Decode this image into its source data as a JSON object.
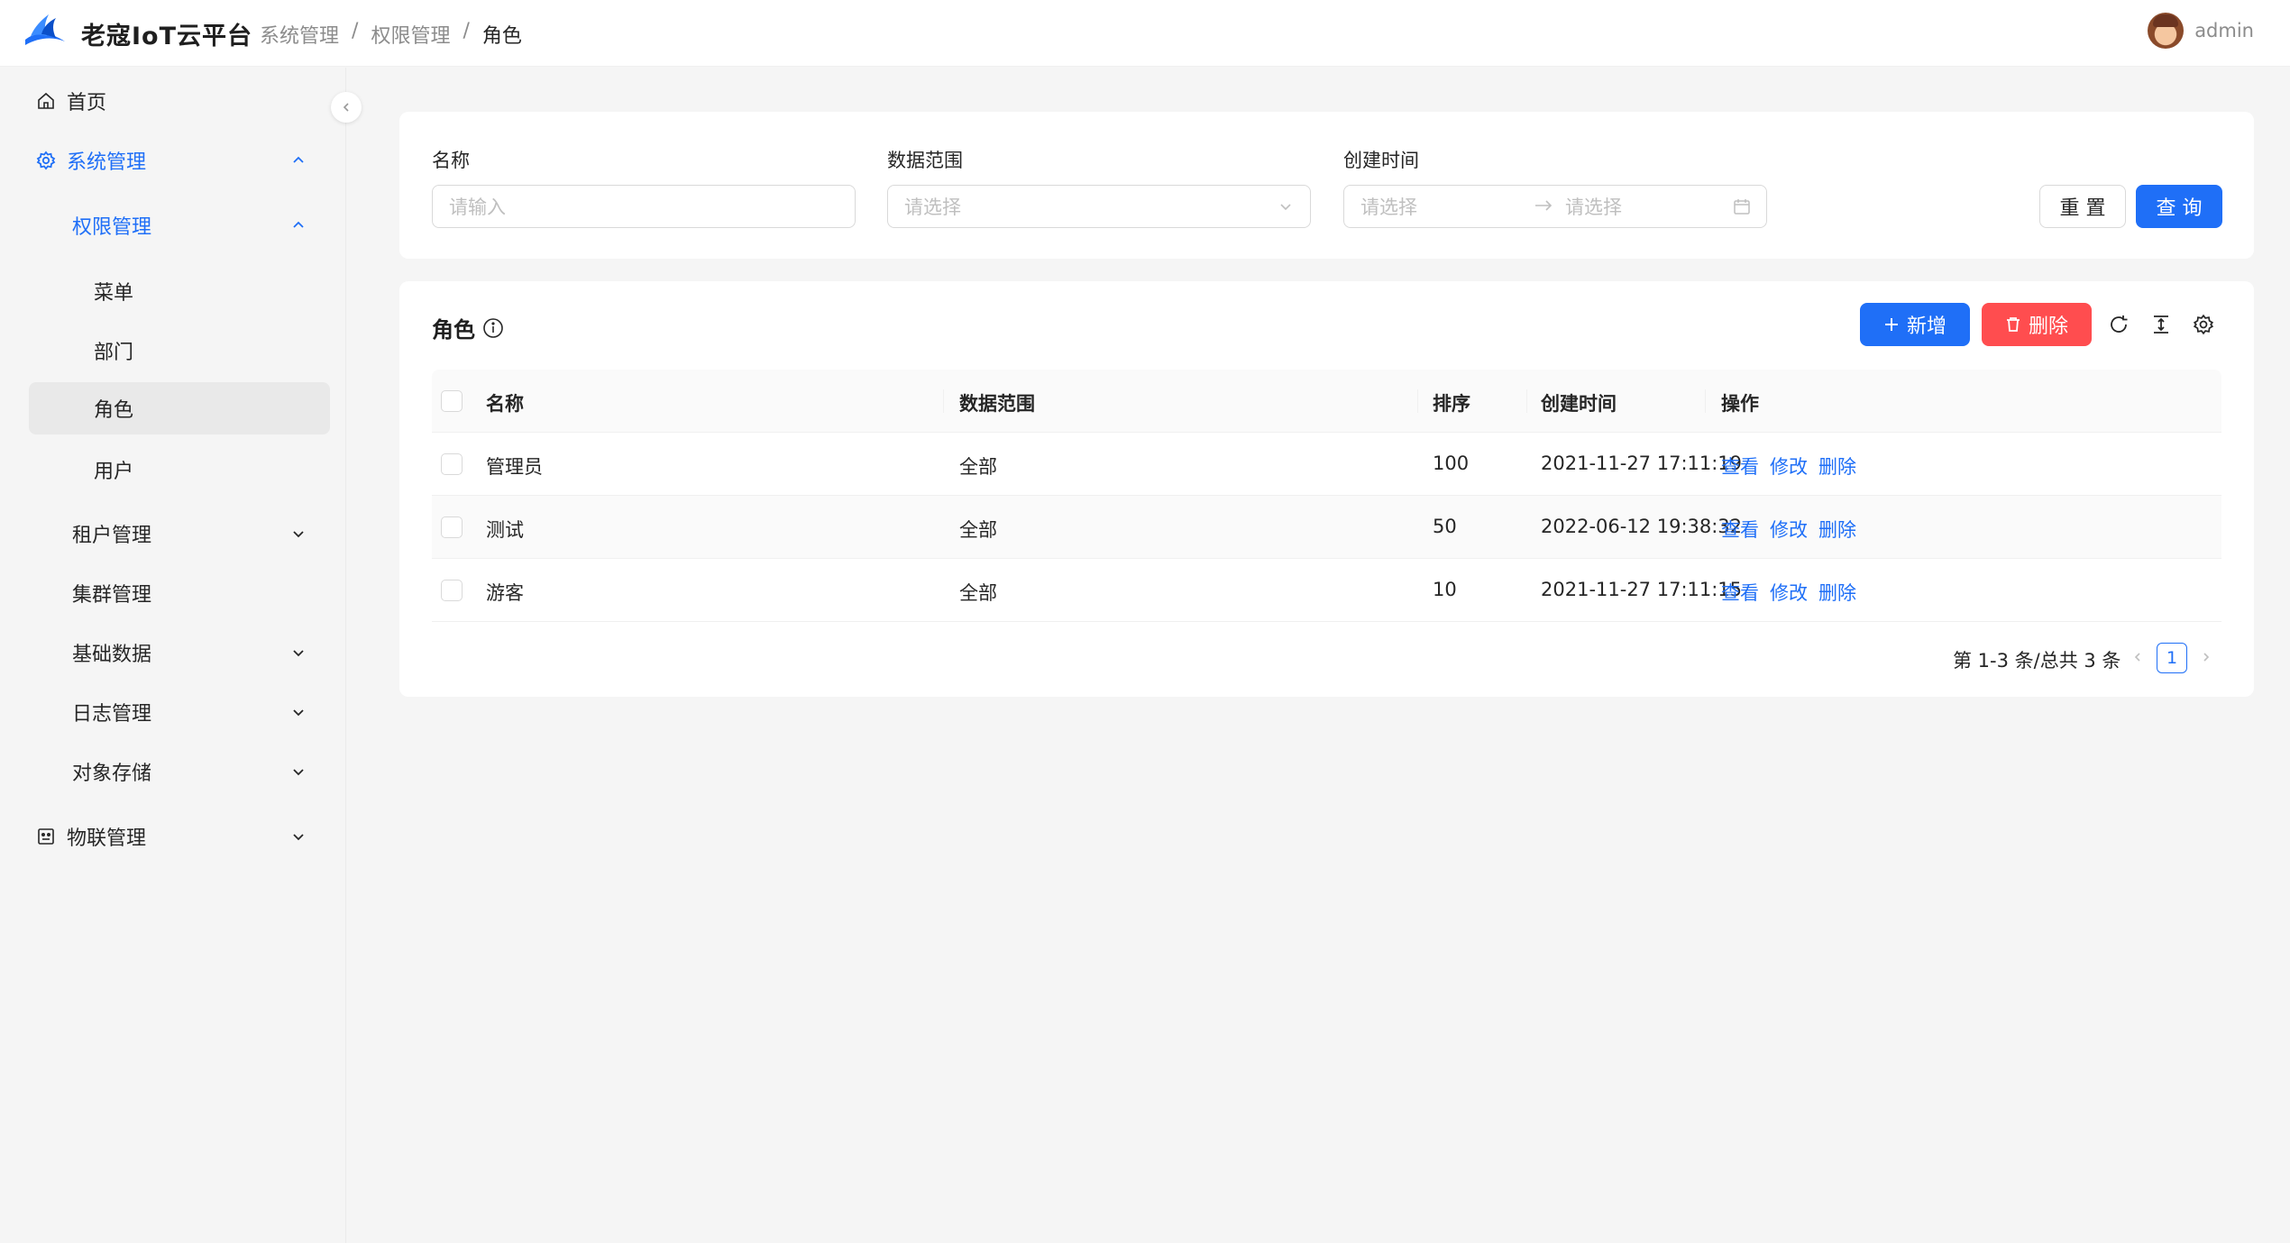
{
  "header": {
    "app_title": "老寇IoT云平台",
    "breadcrumb": [
      "系统管理",
      "权限管理",
      "角色"
    ],
    "breadcrumb_sep": "/",
    "username": "admin"
  },
  "sidebar": {
    "collapse_icon": "chevron-left-icon",
    "items": [
      {
        "label": "首页",
        "icon": "home-icon"
      },
      {
        "label": "系统管理",
        "icon": "gear-icon",
        "expanded": true
      },
      {
        "label": "权限管理",
        "expanded": true
      },
      {
        "label": "菜单"
      },
      {
        "label": "部门"
      },
      {
        "label": "角色",
        "selected": true
      },
      {
        "label": "用户"
      },
      {
        "label": "租户管理"
      },
      {
        "label": "集群管理"
      },
      {
        "label": "基础数据"
      },
      {
        "label": "日志管理"
      },
      {
        "label": "对象存储"
      },
      {
        "label": "物联管理",
        "icon": "robot-icon"
      }
    ]
  },
  "search": {
    "name_label": "名称",
    "name_placeholder": "请输入",
    "scope_label": "数据范围",
    "scope_placeholder": "请选择",
    "time_label": "创建时间",
    "time_start_placeholder": "请选择",
    "time_end_placeholder": "请选择",
    "reset_label": "重 置",
    "query_label": "查 询"
  },
  "table": {
    "title": "角色",
    "add_label": "新增",
    "delete_label": "删除",
    "columns": [
      "名称",
      "数据范围",
      "排序",
      "创建时间",
      "操作"
    ],
    "rows": [
      {
        "name": "管理员",
        "scope": "全部",
        "sort": "100",
        "created": "2021-11-27 17:11:19"
      },
      {
        "name": "测试",
        "scope": "全部",
        "sort": "50",
        "created": "2022-06-12 19:38:32"
      },
      {
        "name": "游客",
        "scope": "全部",
        "sort": "10",
        "created": "2021-11-27 17:11:15"
      }
    ],
    "actions": [
      "查看",
      "修改",
      "删除"
    ],
    "pagination": {
      "summary": "第 1-3 条/总共 3 条",
      "current_page": "1"
    }
  },
  "colors": {
    "primary": "#1f6ff7",
    "danger": "#ff4d4f"
  }
}
